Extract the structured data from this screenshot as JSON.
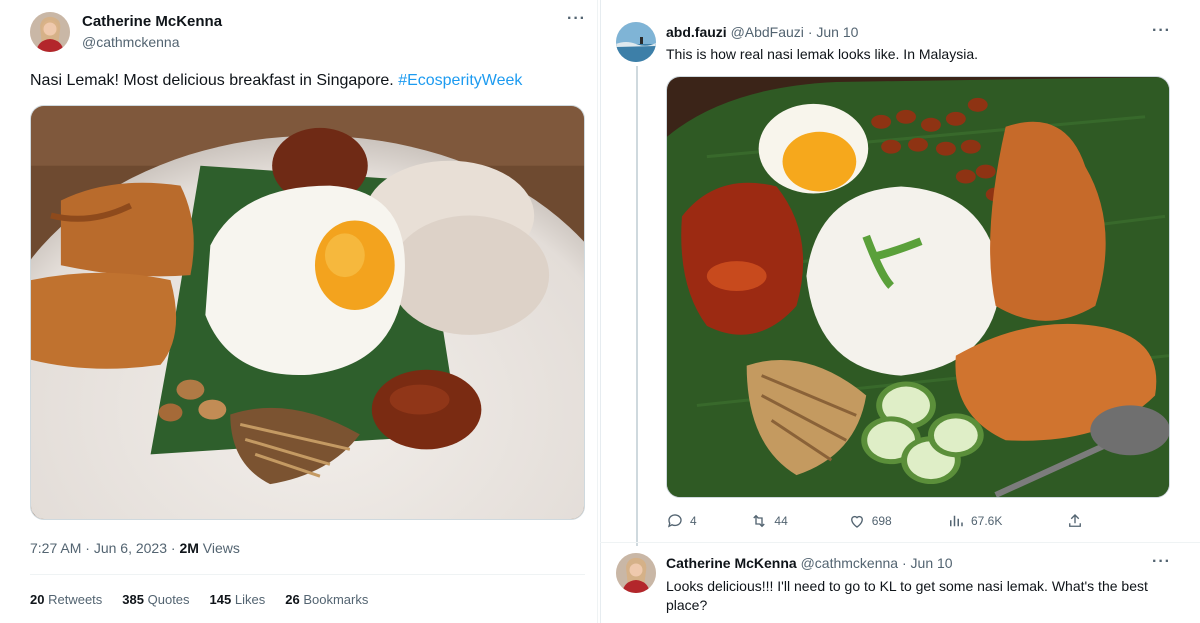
{
  "left_tweet": {
    "author_name": "Catherine McKenna",
    "author_handle": "@cathmckenna",
    "text_main": "Nasi Lemak! Most delicious breakfast in Singapore.",
    "hashtag": "#EcosperityWeek",
    "time": "7:27 AM",
    "date": "Jun 6, 2023",
    "views_count": "2M",
    "views_label": "Views",
    "retweets_count": "20",
    "retweets_label": "Retweets",
    "quotes_count": "385",
    "quotes_label": "Quotes",
    "likes_count": "145",
    "likes_label": "Likes",
    "bookmarks_count": "26",
    "bookmarks_label": "Bookmarks",
    "more_icon": "ellipsis-icon"
  },
  "right_tweet": {
    "author_name": "abd.fauzi",
    "author_handle": "@AbdFauzi",
    "date": "Jun 10",
    "text": "This is how real nasi lemak looks like. In Malaysia.",
    "replies": "4",
    "retweets": "44",
    "likes": "698",
    "views": "67.6K",
    "more_icon": "ellipsis-icon"
  },
  "reply_tweet": {
    "author_name": "Catherine McKenna",
    "author_handle": "@cathmckenna",
    "date": "Jun 10",
    "text_line1": "Looks delicious!!! I'll need to go to KL to get some nasi lemak. What's the best",
    "text_line2": "place?"
  },
  "separator": "·",
  "colors": {
    "accent": "#1d9bf0",
    "text": "#0f1419",
    "muted": "#536471",
    "border": "#cfd9de"
  }
}
